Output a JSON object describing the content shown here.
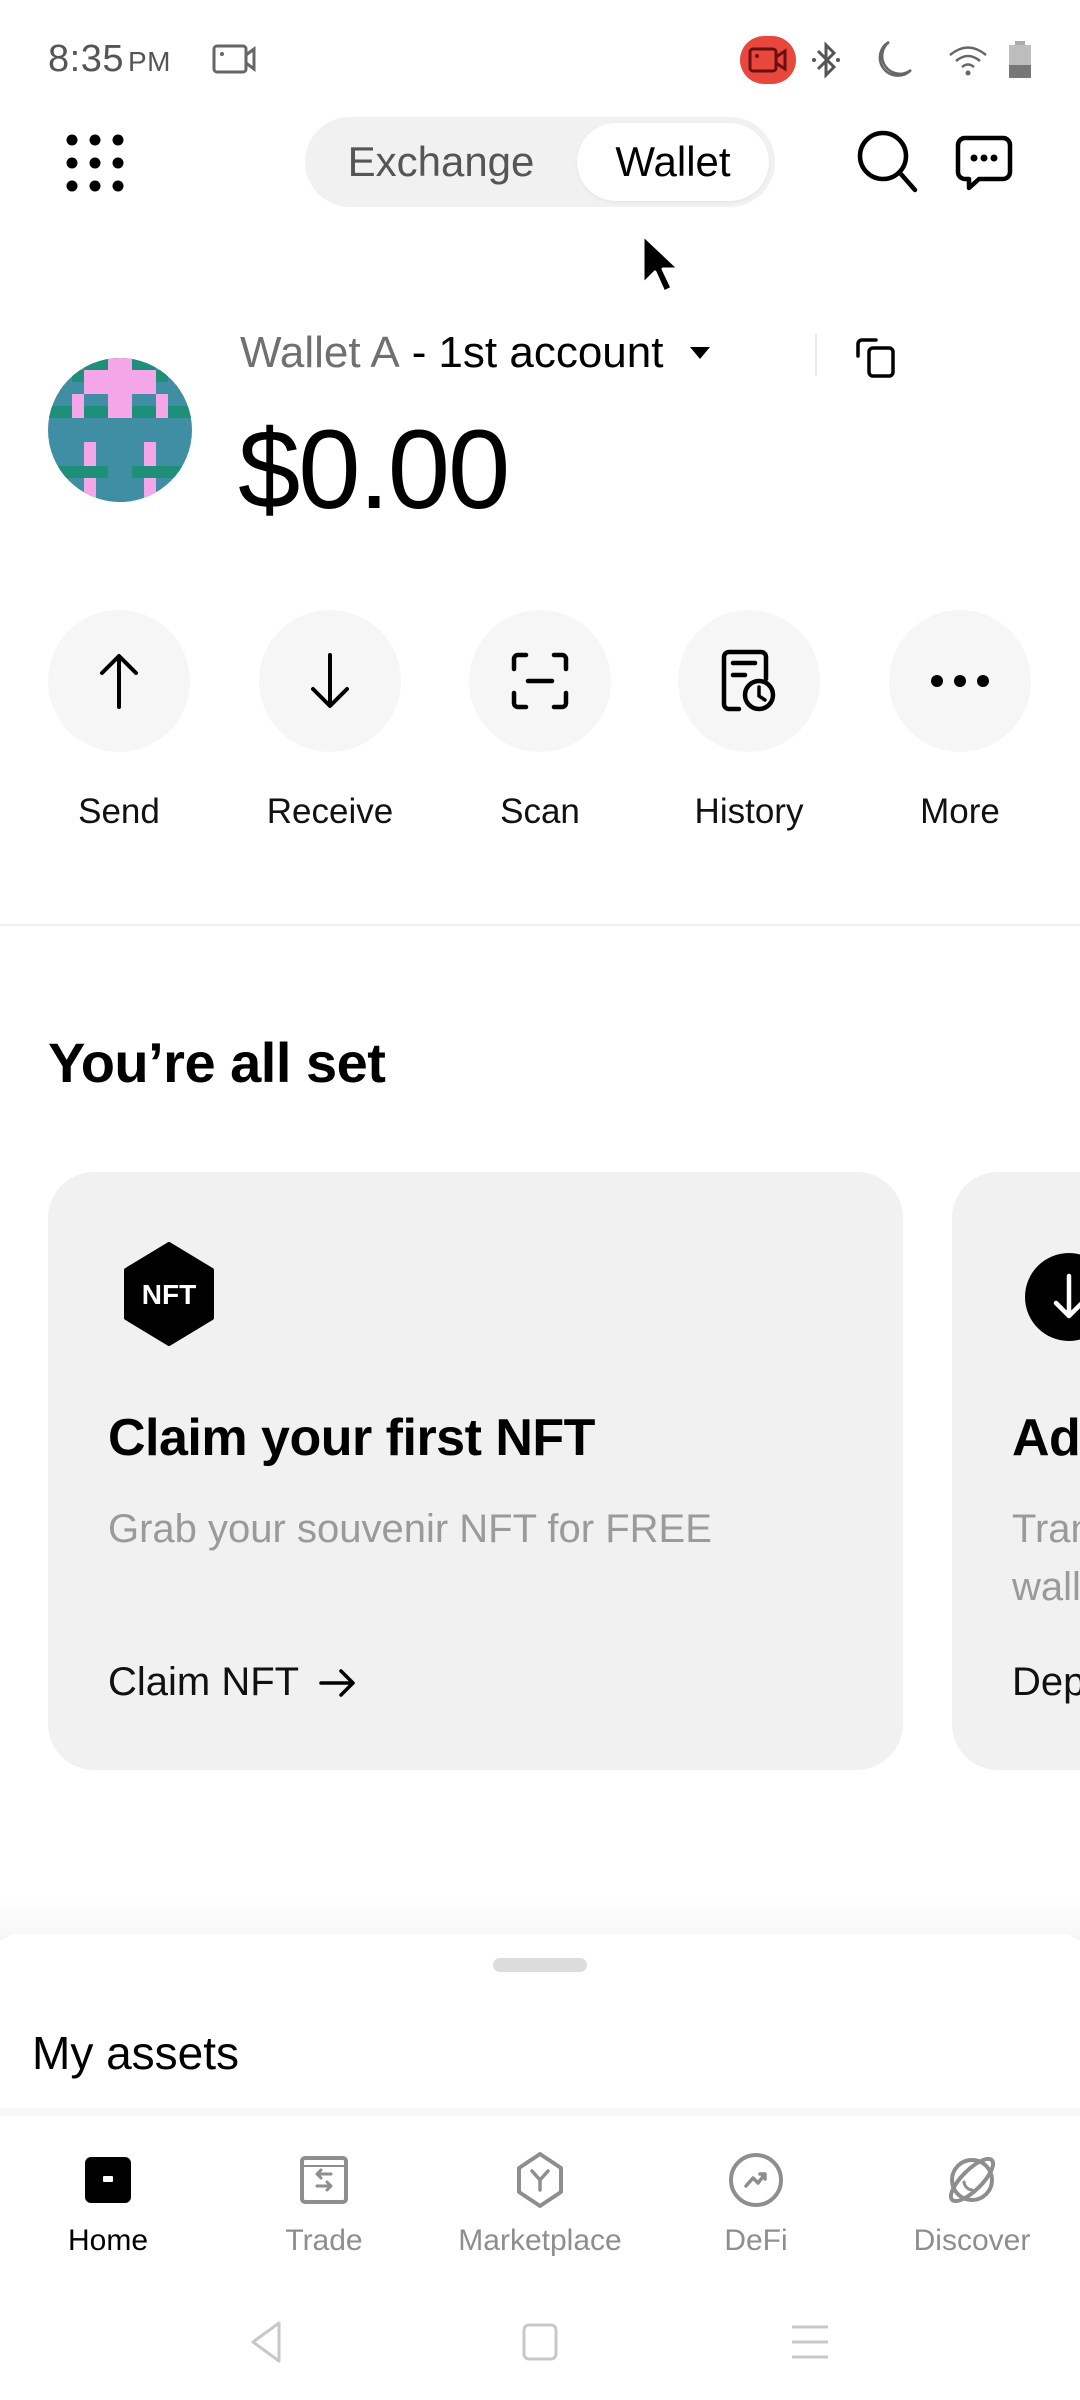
{
  "status_bar": {
    "time": "8:35",
    "ampm": "PM",
    "icons": [
      "screen-record-icon",
      "recording-badge-icon",
      "bluetooth-icon",
      "do-not-disturb-moon-icon",
      "wifi-icon",
      "battery-icon"
    ],
    "recording_color": "#e8473c"
  },
  "top_nav": {
    "menu_icon": "apps-grid-icon",
    "segments": [
      {
        "label": "Exchange",
        "selected": false
      },
      {
        "label": "Wallet",
        "selected": true
      }
    ],
    "right_icons": [
      "search-icon",
      "chat-icon"
    ]
  },
  "account": {
    "wallet_name": "Wallet A",
    "separator": "-",
    "account_name": "1st account",
    "balance": "$0.00",
    "avatar_colors": {
      "base": "#3f8ea3",
      "accent": "#f4a6e8",
      "green": "#1e9079"
    }
  },
  "actions": [
    {
      "label": "Send",
      "icon": "arrow-up-icon"
    },
    {
      "label": "Receive",
      "icon": "arrow-down-icon"
    },
    {
      "label": "Scan",
      "icon": "scan-icon"
    },
    {
      "label": "History",
      "icon": "history-icon"
    },
    {
      "label": "More",
      "icon": "more-dots-icon"
    }
  ],
  "onboarding": {
    "title": "You’re all set",
    "cards": [
      {
        "icon": "nft-badge-icon",
        "icon_text": "NFT",
        "title": "Claim your first NFT",
        "subtitle": "Grab your souvenir NFT for FREE",
        "cta": "Claim NFT"
      },
      {
        "icon": "deposit-arrow-icon",
        "title": "Ad",
        "subtitle": "Tran\nwall",
        "cta": "Dep"
      }
    ]
  },
  "assets_sheet": {
    "title": "My assets"
  },
  "tab_bar": {
    "tabs": [
      {
        "label": "Home",
        "icon": "home-wallet-icon",
        "active": true
      },
      {
        "label": "Trade",
        "icon": "trade-swap-icon",
        "active": false
      },
      {
        "label": "Marketplace",
        "icon": "marketplace-hex-icon",
        "active": false
      },
      {
        "label": "DeFi",
        "icon": "defi-chart-icon",
        "active": false
      },
      {
        "label": "Discover",
        "icon": "discover-planet-icon",
        "active": false
      }
    ]
  },
  "system_nav": {
    "buttons": [
      "back-icon",
      "home-icon",
      "recents-icon"
    ]
  }
}
